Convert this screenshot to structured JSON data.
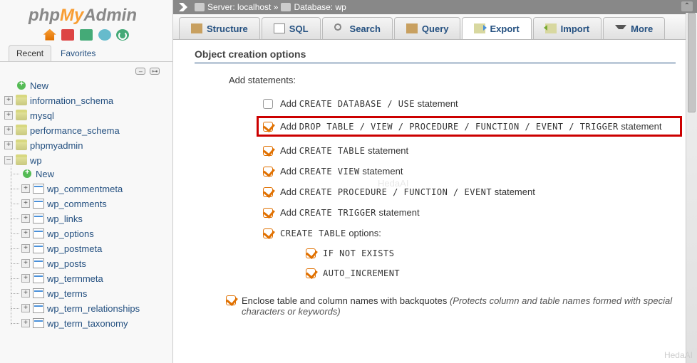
{
  "logo": {
    "part1": "php",
    "part2": "My",
    "part3": "Admin"
  },
  "sidebar": {
    "panelTabs": {
      "recent": "Recent",
      "favorites": "Favorites"
    },
    "newLabel": "New",
    "databases": [
      {
        "name": "information_schema",
        "expanded": false
      },
      {
        "name": "mysql",
        "expanded": false
      },
      {
        "name": "performance_schema",
        "expanded": false
      },
      {
        "name": "phpmyadmin",
        "expanded": false
      }
    ],
    "openDb": {
      "name": "wp",
      "newLabel": "New",
      "tables": [
        "wp_commentmeta",
        "wp_comments",
        "wp_links",
        "wp_options",
        "wp_postmeta",
        "wp_posts",
        "wp_termmeta",
        "wp_terms",
        "wp_term_relationships",
        "wp_term_taxonomy"
      ]
    }
  },
  "breadcrumb": {
    "serverLabel": "Server:",
    "serverName": "localhost",
    "sep": "»",
    "dbLabel": "Database:",
    "dbName": "wp"
  },
  "tabs": {
    "structure": "Structure",
    "sql": "SQL",
    "search": "Search",
    "query": "Query",
    "export": "Export",
    "import": "Import",
    "more": "More"
  },
  "content": {
    "sectionTitle": "Object creation options",
    "subhead": "Add statements:",
    "opts": {
      "createDbPre": "Add ",
      "createDbCaps": "CREATE DATABASE / USE",
      "createDbPost": " statement",
      "dropPre": "Add ",
      "dropCaps": "DROP TABLE / VIEW / PROCEDURE / FUNCTION / EVENT / TRIGGER",
      "dropPost": " statement",
      "createTablePre": "Add ",
      "createTableCaps": "CREATE TABLE",
      "createTablePost": " statement",
      "createViewPre": "Add ",
      "createViewCaps": "CREATE VIEW",
      "createViewPost": " statement",
      "createProcPre": "Add ",
      "createProcCaps": "CREATE PROCEDURE / FUNCTION / EVENT",
      "createProcPost": " statement",
      "createTrigPre": "Add ",
      "createTrigCaps": "CREATE TRIGGER",
      "createTrigPost": " statement",
      "ctOptionsCaps": "CREATE TABLE",
      "ctOptionsPost": " options:",
      "ifNotExists": "IF NOT EXISTS",
      "autoInc": "AUTO_INCREMENT"
    },
    "enclose": {
      "text": "Enclose table and column names with backquotes ",
      "hint": "(Protects column and table names formed with special characters or keywords)"
    }
  },
  "watermark": "HedaAI"
}
